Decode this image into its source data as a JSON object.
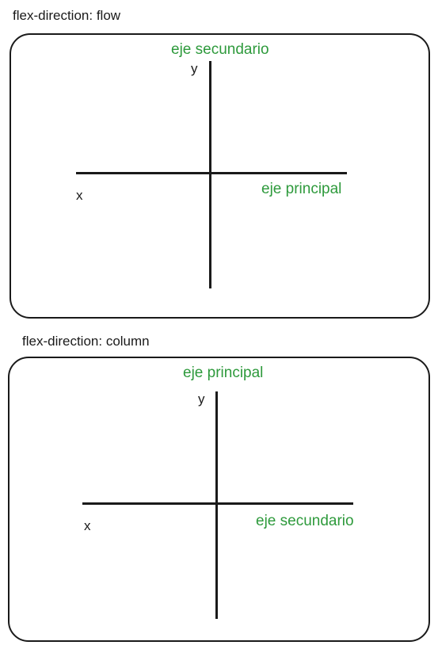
{
  "diagrams": [
    {
      "caption": "flex-direction: flow",
      "vertical_axis_label": "eje secundario",
      "horizontal_axis_label": "eje principal",
      "y_letter": "y",
      "x_letter": "x"
    },
    {
      "caption": "flex-direction: column",
      "vertical_axis_label": "eje principal",
      "horizontal_axis_label": "eje secundario",
      "y_letter": "y",
      "x_letter": "x"
    }
  ],
  "colors": {
    "line": "#1a1a1a",
    "label_green": "#2e9a3c"
  }
}
